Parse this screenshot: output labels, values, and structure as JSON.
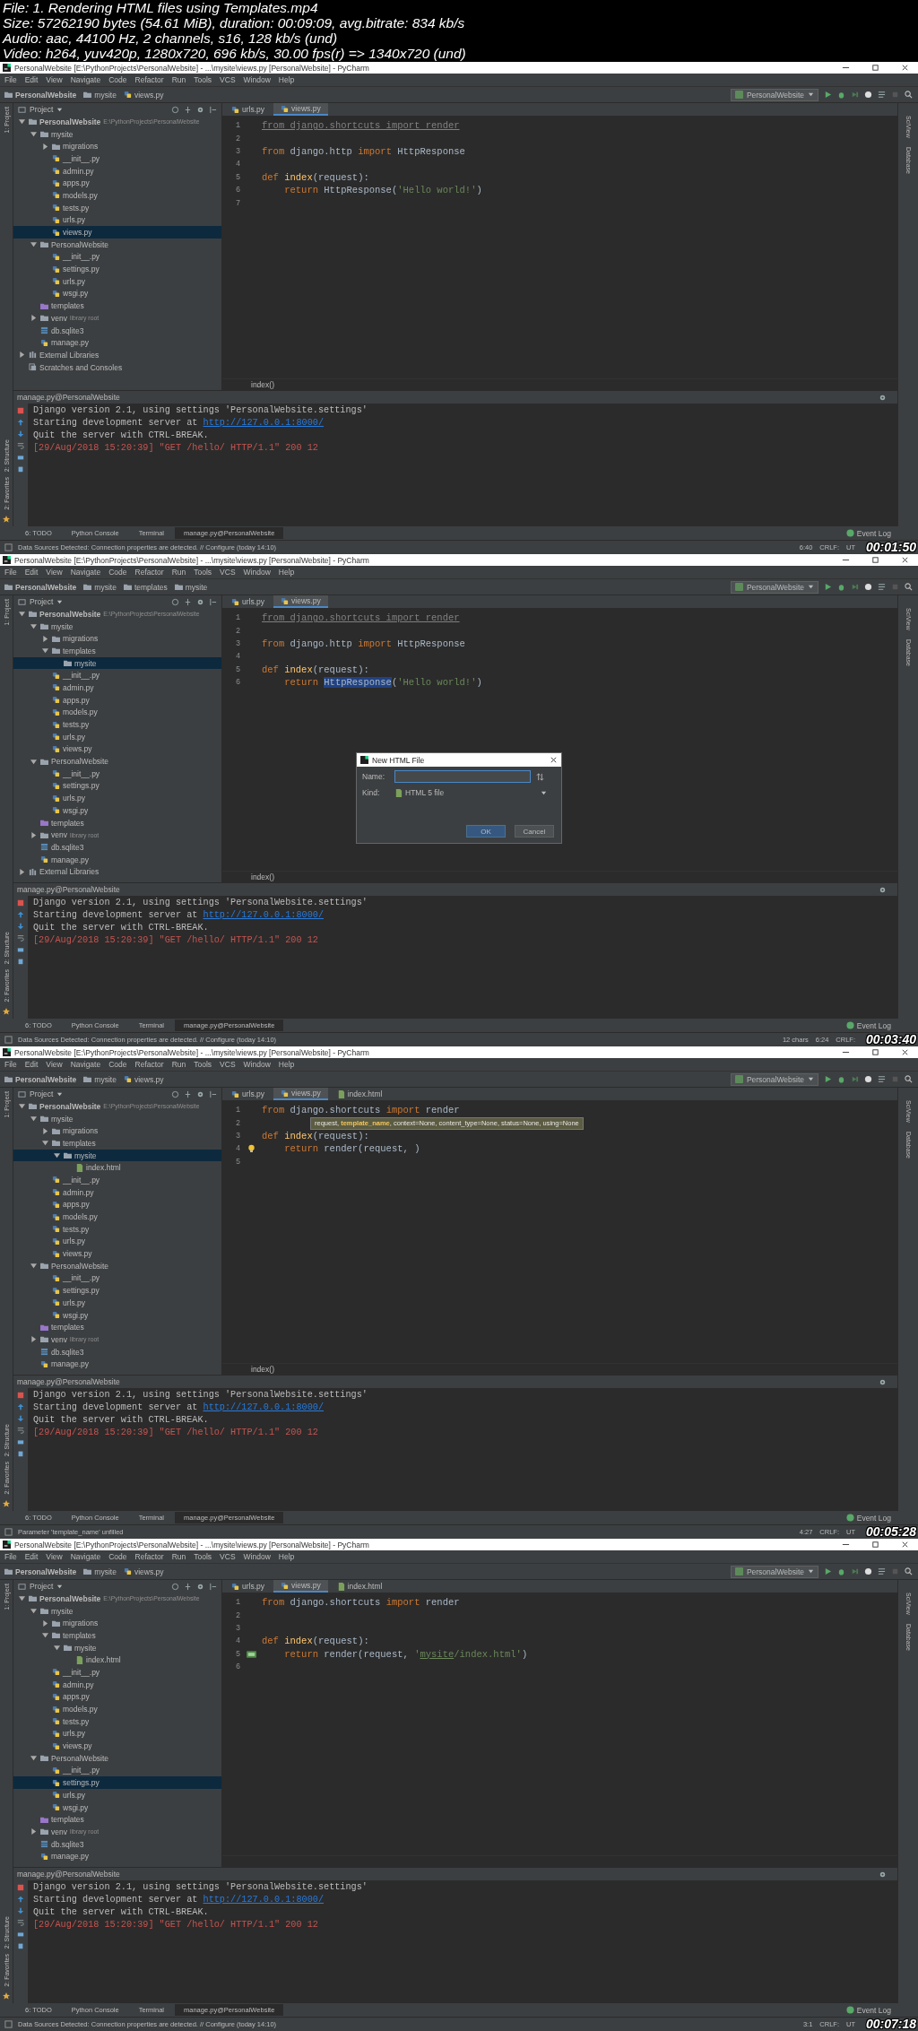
{
  "header": {
    "lines": [
      "File: 1. Rendering HTML files using Templates.mp4",
      "Size: 57262190 bytes (54.61 MiB), duration: 00:09:09, avg.bitrate: 834 kb/s",
      "Audio: aac, 44100 Hz, 2 channels, s16, 128 kb/s (und)",
      "Video: h264, yuv420p, 1280x720, 696 kb/s, 30.00 fps(r) => 1340x720 (und)"
    ]
  },
  "frames": [
    {
      "window_title": "PersonalWebsite [E:\\PythonProjects\\PersonalWebsite] - ...\\mysite\\views.py [PersonalWebsite] - PyCharm",
      "menu": [
        "File",
        "Edit",
        "View",
        "Navigate",
        "Code",
        "Refactor",
        "Run",
        "Tools",
        "VCS",
        "Window",
        "Help"
      ],
      "breadcrumbs": [
        {
          "label": "PersonalWebsite",
          "kind": "project"
        },
        {
          "label": "mysite",
          "kind": "folder"
        },
        {
          "label": "views.py",
          "kind": "py"
        }
      ],
      "run_config": "PersonalWebsite",
      "project_label": "Project",
      "left_tools": [
        "1: Project",
        "2: Structure",
        "2: Favorites"
      ],
      "right_tools": [
        "SciView",
        "Database"
      ],
      "tabs": [
        {
          "label": "urls.py",
          "kind": "py",
          "selected": false
        },
        {
          "label": "views.py",
          "kind": "py",
          "selected": true
        }
      ],
      "tree": [
        {
          "label": "PersonalWebsite",
          "kind": "project",
          "note": "E:\\PythonProjects\\PersonalWebsite",
          "expanded": true,
          "selected": false,
          "children": [
            {
              "label": "mysite",
              "kind": "folder",
              "expanded": true,
              "selected": false,
              "children": [
                {
                  "label": "migrations",
                  "kind": "folder",
                  "expanded": false,
                  "selected": false
                },
                {
                  "label": "__init__.py",
                  "kind": "py",
                  "selected": false
                },
                {
                  "label": "admin.py",
                  "kind": "py",
                  "selected": false
                },
                {
                  "label": "apps.py",
                  "kind": "py",
                  "selected": false
                },
                {
                  "label": "models.py",
                  "kind": "py",
                  "selected": false
                },
                {
                  "label": "tests.py",
                  "kind": "py",
                  "selected": false
                },
                {
                  "label": "urls.py",
                  "kind": "py",
                  "selected": false
                },
                {
                  "label": "views.py",
                  "kind": "py",
                  "selected": true
                }
              ]
            },
            {
              "label": "PersonalWebsite",
              "kind": "folder",
              "expanded": true,
              "selected": false,
              "children": [
                {
                  "label": "__init__.py",
                  "kind": "py",
                  "selected": false
                },
                {
                  "label": "settings.py",
                  "kind": "py",
                  "selected": false
                },
                {
                  "label": "urls.py",
                  "kind": "py",
                  "selected": false
                },
                {
                  "label": "wsgi.py",
                  "kind": "py",
                  "selected": false
                }
              ]
            },
            {
              "label": "templates",
              "kind": "templates",
              "selected": false
            },
            {
              "label": "venv",
              "kind": "folder",
              "note": "library root",
              "expanded": false,
              "selected": false
            },
            {
              "label": "db.sqlite3",
              "kind": "db",
              "selected": false
            },
            {
              "label": "manage.py",
              "kind": "py",
              "selected": false
            }
          ]
        },
        {
          "label": "External Libraries",
          "kind": "libs",
          "expanded": false,
          "selected": false
        },
        {
          "label": "Scratches and Consoles",
          "kind": "scratch",
          "selected": false
        }
      ],
      "code": [
        {
          "n": "1",
          "tokens": [
            {
              "text": "from django.shortcuts import render",
              "kind": "unused"
            }
          ]
        },
        {
          "n": "2"
        },
        {
          "n": "3",
          "tokens": [
            {
              "text": "from",
              "kind": "kw"
            },
            {
              "text": "django.http",
              "kind": "plain",
              "space": true
            },
            {
              "text": "import",
              "kind": "kw",
              "space": true
            },
            {
              "text": "HttpResponse",
              "kind": "plain",
              "space": true
            }
          ]
        },
        {
          "n": "4"
        },
        {
          "n": "5",
          "tokens": [
            {
              "text": "def",
              "kind": "kw"
            },
            {
              "text": "index",
              "kind": "fn",
              "space": true
            },
            {
              "text": "(request):",
              "kind": "plain"
            }
          ]
        },
        {
          "n": "6",
          "indented": true,
          "tokens": [
            {
              "text": "return",
              "kind": "kw"
            },
            {
              "text": "HttpResponse(",
              "kind": "plain",
              "space": true
            },
            {
              "text": "'Hello world!'",
              "kind": "str"
            },
            {
              "text": ")",
              "kind": "plain"
            }
          ]
        },
        {
          "n": "7"
        }
      ],
      "editor_footer": "index()",
      "run_title": "manage.py@PersonalWebsite",
      "console": [
        {
          "kind": "info",
          "text": "Django version 2.1, using settings 'PersonalWebsite.settings'"
        },
        {
          "kind": "info",
          "text": "Starting development server at ",
          "link": "http://127.0.0.1:8000/"
        },
        {
          "kind": "info",
          "text": "Quit the server with CTRL-BREAK."
        },
        {
          "kind": "log",
          "text": "[29/Aug/2018 15:20:39] \"GET /hello/ HTTP/1.1\" 200 12"
        }
      ],
      "tool_tabs": [
        {
          "label": "6: TODO",
          "selected": false
        },
        {
          "label": "Python Console",
          "selected": false
        },
        {
          "label": "Terminal",
          "selected": false
        },
        {
          "label": "manage.py@PersonalWebsite",
          "selected": true
        }
      ],
      "event_log": "Event Log",
      "status": "Data Sources Detected: Connection properties are detected. // Configure (today 14:10)",
      "status_right": [
        "6:40",
        "CRLF:",
        "UT"
      ],
      "timestamp": "00:01:50"
    },
    {
      "window_title": "PersonalWebsite [E:\\PythonProjects\\PersonalWebsite] - ...\\mysite\\views.py [PersonalWebsite] - PyCharm",
      "menu": [
        "File",
        "Edit",
        "View",
        "Navigate",
        "Code",
        "Refactor",
        "Run",
        "Tools",
        "VCS",
        "Window",
        "Help"
      ],
      "breadcrumbs": [
        {
          "label": "PersonalWebsite",
          "kind": "project"
        },
        {
          "label": "mysite",
          "kind": "folder"
        },
        {
          "label": "templates",
          "kind": "folder"
        },
        {
          "label": "mysite",
          "kind": "folder"
        }
      ],
      "run_config": "PersonalWebsite",
      "project_label": "Project",
      "left_tools": [
        "1: Project",
        "2: Structure",
        "2: Favorites"
      ],
      "right_tools": [
        "SciView",
        "Database"
      ],
      "tabs": [
        {
          "label": "urls.py",
          "kind": "py",
          "selected": false
        },
        {
          "label": "views.py",
          "kind": "py",
          "selected": true
        }
      ],
      "tree": [
        {
          "label": "PersonalWebsite",
          "kind": "project",
          "note": "E:\\PythonProjects\\PersonalWebsite",
          "expanded": true,
          "selected": false,
          "children": [
            {
              "label": "mysite",
              "kind": "folder",
              "expanded": true,
              "selected": false,
              "children": [
                {
                  "label": "migrations",
                  "kind": "folder",
                  "expanded": false,
                  "selected": false
                },
                {
                  "label": "templates",
                  "kind": "folder",
                  "expanded": true,
                  "selected": false,
                  "children": [
                    {
                      "label": "mysite",
                      "kind": "folder",
                      "selected": true
                    }
                  ]
                },
                {
                  "label": "__init__.py",
                  "kind": "py",
                  "selected": false
                },
                {
                  "label": "admin.py",
                  "kind": "py",
                  "selected": false
                },
                {
                  "label": "apps.py",
                  "kind": "py",
                  "selected": false
                },
                {
                  "label": "models.py",
                  "kind": "py",
                  "selected": false
                },
                {
                  "label": "tests.py",
                  "kind": "py",
                  "selected": false
                },
                {
                  "label": "urls.py",
                  "kind": "py",
                  "selected": false
                },
                {
                  "label": "views.py",
                  "kind": "py",
                  "selected": false
                }
              ]
            },
            {
              "label": "PersonalWebsite",
              "kind": "folder",
              "expanded": true,
              "selected": false,
              "children": [
                {
                  "label": "__init__.py",
                  "kind": "py",
                  "selected": false
                },
                {
                  "label": "settings.py",
                  "kind": "py",
                  "selected": false
                },
                {
                  "label": "urls.py",
                  "kind": "py",
                  "selected": false
                },
                {
                  "label": "wsgi.py",
                  "kind": "py",
                  "selected": false
                }
              ]
            },
            {
              "label": "templates",
              "kind": "templates",
              "selected": false
            },
            {
              "label": "venv",
              "kind": "folder",
              "note": "library root",
              "expanded": false,
              "selected": false
            },
            {
              "label": "db.sqlite3",
              "kind": "db",
              "selected": false
            },
            {
              "label": "manage.py",
              "kind": "py",
              "selected": false
            }
          ]
        },
        {
          "label": "External Libraries",
          "kind": "libs",
          "expanded": false,
          "selected": false
        }
      ],
      "code": [
        {
          "n": "1",
          "tokens": [
            {
              "text": "from django.shortcuts import render",
              "kind": "unused"
            }
          ]
        },
        {
          "n": "2"
        },
        {
          "n": "3",
          "tokens": [
            {
              "text": "from",
              "kind": "kw"
            },
            {
              "text": "django.http",
              "kind": "plain",
              "space": true
            },
            {
              "text": "import",
              "kind": "kw",
              "space": true
            },
            {
              "text": "HttpResponse",
              "kind": "plain",
              "space": true
            }
          ]
        },
        {
          "n": "4"
        },
        {
          "n": "5",
          "tokens": [
            {
              "text": "def",
              "kind": "kw"
            },
            {
              "text": "index",
              "kind": "fn",
              "space": true
            },
            {
              "text": "(request):",
              "kind": "plain"
            }
          ]
        },
        {
          "n": "6",
          "indented": true,
          "tokens": [
            {
              "text": "return",
              "kind": "kw"
            },
            {
              "text": "HttpResponse",
              "kind": "sel",
              "space": true
            },
            {
              "text": "(",
              "kind": "plain"
            },
            {
              "text": "'Hello world!'",
              "kind": "str"
            },
            {
              "text": ")",
              "kind": "plain"
            }
          ]
        }
      ],
      "editor_footer": "index()",
      "run_title": "manage.py@PersonalWebsite",
      "console": [
        {
          "kind": "info",
          "text": "Django version 2.1, using settings 'PersonalWebsite.settings'"
        },
        {
          "kind": "info",
          "text": "Starting development server at ",
          "link": "http://127.0.0.1:8000/"
        },
        {
          "kind": "info",
          "text": "Quit the server with CTRL-BREAK."
        },
        {
          "kind": "log",
          "text": "[29/Aug/2018 15:20:39] \"GET /hello/ HTTP/1.1\" 200 12"
        }
      ],
      "tool_tabs": [
        {
          "label": "6: TODO",
          "selected": false
        },
        {
          "label": "Python Console",
          "selected": false
        },
        {
          "label": "Terminal",
          "selected": false
        },
        {
          "label": "manage.py@PersonalWebsite",
          "selected": true
        }
      ],
      "event_log": "Event Log",
      "status": "Data Sources Detected: Connection properties are detected. // Configure (today 14:10)",
      "status_right": [
        "12 chars",
        "6:24",
        "CRLF:"
      ],
      "timestamp": "00:03:40",
      "dialog": {
        "title": "New HTML File",
        "name_label": "Name:",
        "kind_label": "Kind:",
        "kind_value": "HTML 5 file",
        "buttons": [
          {
            "label": "OK",
            "selected": true
          },
          {
            "label": "Cancel",
            "selected": false
          }
        ]
      }
    },
    {
      "window_title": "PersonalWebsite [E:\\PythonProjects\\PersonalWebsite] - ...\\mysite\\views.py [PersonalWebsite] - PyCharm",
      "menu": [
        "File",
        "Edit",
        "View",
        "Navigate",
        "Code",
        "Refactor",
        "Run",
        "Tools",
        "VCS",
        "Window",
        "Help"
      ],
      "breadcrumbs": [
        {
          "label": "PersonalWebsite",
          "kind": "project"
        },
        {
          "label": "mysite",
          "kind": "folder"
        },
        {
          "label": "views.py",
          "kind": "py"
        }
      ],
      "run_config": "PersonalWebsite",
      "project_label": "Project",
      "left_tools": [
        "1: Project",
        "2: Structure",
        "2: Favorites"
      ],
      "right_tools": [
        "SciView",
        "Database"
      ],
      "tabs": [
        {
          "label": "urls.py",
          "kind": "py",
          "selected": false
        },
        {
          "label": "views.py",
          "kind": "py",
          "selected": true
        },
        {
          "label": "index.html",
          "kind": "html",
          "selected": false
        }
      ],
      "tree": [
        {
          "label": "PersonalWebsite",
          "kind": "project",
          "note": "E:\\PythonProjects\\PersonalWebsite",
          "expanded": true,
          "selected": false,
          "children": [
            {
              "label": "mysite",
              "kind": "folder",
              "expanded": true,
              "selected": false,
              "children": [
                {
                  "label": "migrations",
                  "kind": "folder",
                  "expanded": false,
                  "selected": false
                },
                {
                  "label": "templates",
                  "kind": "folder",
                  "expanded": true,
                  "selected": false,
                  "children": [
                    {
                      "label": "mysite",
                      "kind": "folder",
                      "expanded": true,
                      "selected": true,
                      "children": [
                        {
                          "label": "index.html",
                          "kind": "html",
                          "selected": false
                        }
                      ]
                    }
                  ]
                },
                {
                  "label": "__init__.py",
                  "kind": "py",
                  "selected": false
                },
                {
                  "label": "admin.py",
                  "kind": "py",
                  "selected": false
                },
                {
                  "label": "apps.py",
                  "kind": "py",
                  "selected": false
                },
                {
                  "label": "models.py",
                  "kind": "py",
                  "selected": false
                },
                {
                  "label": "tests.py",
                  "kind": "py",
                  "selected": false
                },
                {
                  "label": "urls.py",
                  "kind": "py",
                  "selected": false
                },
                {
                  "label": "views.py",
                  "kind": "py",
                  "selected": false
                }
              ]
            },
            {
              "label": "PersonalWebsite",
              "kind": "folder",
              "expanded": true,
              "selected": false,
              "children": [
                {
                  "label": "__init__.py",
                  "kind": "py",
                  "selected": false
                },
                {
                  "label": "settings.py",
                  "kind": "py",
                  "selected": false
                },
                {
                  "label": "urls.py",
                  "kind": "py",
                  "selected": false
                },
                {
                  "label": "wsgi.py",
                  "kind": "py",
                  "selected": false
                }
              ]
            },
            {
              "label": "templates",
              "kind": "templates",
              "selected": false
            },
            {
              "label": "venv",
              "kind": "folder",
              "note": "library root",
              "expanded": false,
              "selected": false
            },
            {
              "label": "db.sqlite3",
              "kind": "db",
              "selected": false
            },
            {
              "label": "manage.py",
              "kind": "py",
              "selected": false
            }
          ]
        }
      ],
      "code": [
        {
          "n": "1",
          "tokens": [
            {
              "text": "from",
              "kind": "kw"
            },
            {
              "text": "django.shortcuts",
              "kind": "plain",
              "space": true
            },
            {
              "text": "import",
              "kind": "kw",
              "space": true
            },
            {
              "text": "render",
              "kind": "plain",
              "space": true
            }
          ]
        },
        {
          "n": "2"
        },
        {
          "n": "3",
          "tokens": [
            {
              "text": "def",
              "kind": "kw"
            },
            {
              "text": "index",
              "kind": "fn",
              "space": true
            },
            {
              "text": "(request):",
              "kind": "plain"
            }
          ]
        },
        {
          "n": "4",
          "bulb": true,
          "indented": true,
          "tokens": [
            {
              "text": "return",
              "kind": "kw"
            },
            {
              "text": "render(request, )",
              "kind": "plain",
              "space": true
            }
          ]
        },
        {
          "n": "5"
        }
      ],
      "tooltip": "request, **template_name**, context=None, content_type=None, status=None, using=None",
      "editor_footer": "index()",
      "run_title": "manage.py@PersonalWebsite",
      "console": [
        {
          "kind": "info",
          "text": "Django version 2.1, using settings 'PersonalWebsite.settings'"
        },
        {
          "kind": "info",
          "text": "Starting development server at ",
          "link": "http://127.0.0.1:8000/"
        },
        {
          "kind": "info",
          "text": "Quit the server with CTRL-BREAK."
        },
        {
          "kind": "log",
          "text": "[29/Aug/2018 15:20:39] \"GET /hello/ HTTP/1.1\" 200 12"
        }
      ],
      "tool_tabs": [
        {
          "label": "6: TODO",
          "selected": false
        },
        {
          "label": "Python Console",
          "selected": false
        },
        {
          "label": "Terminal",
          "selected": false
        },
        {
          "label": "manage.py@PersonalWebsite",
          "selected": true
        }
      ],
      "event_log": "Event Log",
      "status": "Parameter 'template_name' unfilled",
      "status_right": [
        "4:27",
        "CRLF:",
        "UT"
      ],
      "timestamp": "00:05:28"
    },
    {
      "window_title": "PersonalWebsite [E:\\PythonProjects\\PersonalWebsite] - ...\\mysite\\views.py [PersonalWebsite] - PyCharm",
      "menu": [
        "File",
        "Edit",
        "View",
        "Navigate",
        "Code",
        "Refactor",
        "Run",
        "Tools",
        "VCS",
        "Window",
        "Help"
      ],
      "breadcrumbs": [
        {
          "label": "PersonalWebsite",
          "kind": "project"
        },
        {
          "label": "mysite",
          "kind": "folder"
        },
        {
          "label": "views.py",
          "kind": "py"
        }
      ],
      "run_config": "PersonalWebsite",
      "project_label": "Project",
      "left_tools": [
        "1: Project",
        "2: Structure",
        "2: Favorites"
      ],
      "right_tools": [
        "SciView",
        "Database"
      ],
      "tabs": [
        {
          "label": "urls.py",
          "kind": "py",
          "selected": false
        },
        {
          "label": "views.py",
          "kind": "py",
          "selected": true
        },
        {
          "label": "index.html",
          "kind": "html",
          "selected": false
        }
      ],
      "tree": [
        {
          "label": "PersonalWebsite",
          "kind": "project",
          "note": "E:\\PythonProjects\\PersonalWebsite",
          "expanded": true,
          "selected": false,
          "children": [
            {
              "label": "mysite",
              "kind": "folder",
              "expanded": true,
              "selected": false,
              "children": [
                {
                  "label": "migrations",
                  "kind": "folder",
                  "expanded": false,
                  "selected": false
                },
                {
                  "label": "templates",
                  "kind": "folder",
                  "expanded": true,
                  "selected": false,
                  "children": [
                    {
                      "label": "mysite",
                      "kind": "folder",
                      "expanded": true,
                      "selected": false,
                      "children": [
                        {
                          "label": "index.html",
                          "kind": "html",
                          "selected": false
                        }
                      ]
                    }
                  ]
                },
                {
                  "label": "__init__.py",
                  "kind": "py",
                  "selected": false
                },
                {
                  "label": "admin.py",
                  "kind": "py",
                  "selected": false
                },
                {
                  "label": "apps.py",
                  "kind": "py",
                  "selected": false
                },
                {
                  "label": "models.py",
                  "kind": "py",
                  "selected": false
                },
                {
                  "label": "tests.py",
                  "kind": "py",
                  "selected": false
                },
                {
                  "label": "urls.py",
                  "kind": "py",
                  "selected": false
                },
                {
                  "label": "views.py",
                  "kind": "py",
                  "selected": false
                }
              ]
            },
            {
              "label": "PersonalWebsite",
              "kind": "folder",
              "expanded": true,
              "selected": false,
              "children": [
                {
                  "label": "__init__.py",
                  "kind": "py",
                  "selected": false
                },
                {
                  "label": "settings.py",
                  "kind": "py",
                  "selected": true
                },
                {
                  "label": "urls.py",
                  "kind": "py",
                  "selected": false
                },
                {
                  "label": "wsgi.py",
                  "kind": "py",
                  "selected": false
                }
              ]
            },
            {
              "label": "templates",
              "kind": "templates",
              "selected": false
            },
            {
              "label": "venv",
              "kind": "folder",
              "note": "library root",
              "expanded": false,
              "selected": false
            },
            {
              "label": "db.sqlite3",
              "kind": "db",
              "selected": false
            },
            {
              "label": "manage.py",
              "kind": "py",
              "selected": false
            }
          ]
        }
      ],
      "code": [
        {
          "n": "1",
          "tokens": [
            {
              "text": "from",
              "kind": "kw"
            },
            {
              "text": "django.shortcuts",
              "kind": "plain",
              "space": true
            },
            {
              "text": "import",
              "kind": "kw",
              "space": true
            },
            {
              "text": "render",
              "kind": "plain",
              "space": true
            }
          ]
        },
        {
          "n": "2"
        },
        {
          "n": "3"
        },
        {
          "n": "4",
          "tokens": [
            {
              "text": "def",
              "kind": "kw"
            },
            {
              "text": "index",
              "kind": "fn",
              "space": true
            },
            {
              "text": "(request):",
              "kind": "plain"
            }
          ]
        },
        {
          "n": "5",
          "run_marker": true,
          "indented": true,
          "tokens": [
            {
              "text": "return",
              "kind": "kw"
            },
            {
              "text": "render(request,",
              "kind": "plain",
              "space": true
            },
            {
              "text": "'",
              "kind": "str",
              "space": true
            },
            {
              "text": "mysite",
              "kind": "strlink"
            },
            {
              "text": "/index.html'",
              "kind": "str"
            },
            {
              "text": ")",
              "kind": "plain"
            }
          ]
        },
        {
          "n": "6"
        }
      ],
      "run_title": "manage.py@PersonalWebsite",
      "console": [
        {
          "kind": "info",
          "text": "Django version 2.1, using settings 'PersonalWebsite.settings'"
        },
        {
          "kind": "info",
          "text": "Starting development server at ",
          "link": "http://127.0.0.1:8000/"
        },
        {
          "kind": "info",
          "text": "Quit the server with CTRL-BREAK."
        },
        {
          "kind": "log",
          "text": "[29/Aug/2018 15:20:39] \"GET /hello/ HTTP/1.1\" 200 12"
        }
      ],
      "tool_tabs": [
        {
          "label": "6: TODO",
          "selected": false
        },
        {
          "label": "Python Console",
          "selected": false
        },
        {
          "label": "Terminal",
          "selected": false
        },
        {
          "label": "manage.py@PersonalWebsite",
          "selected": true
        }
      ],
      "event_log": "Event Log",
      "status": "Data Sources Detected: Connection properties are detected. // Configure (today 14:10)",
      "status_right": [
        "3:1",
        "CRLF:",
        "UT"
      ],
      "timestamp": "00:07:18"
    }
  ]
}
